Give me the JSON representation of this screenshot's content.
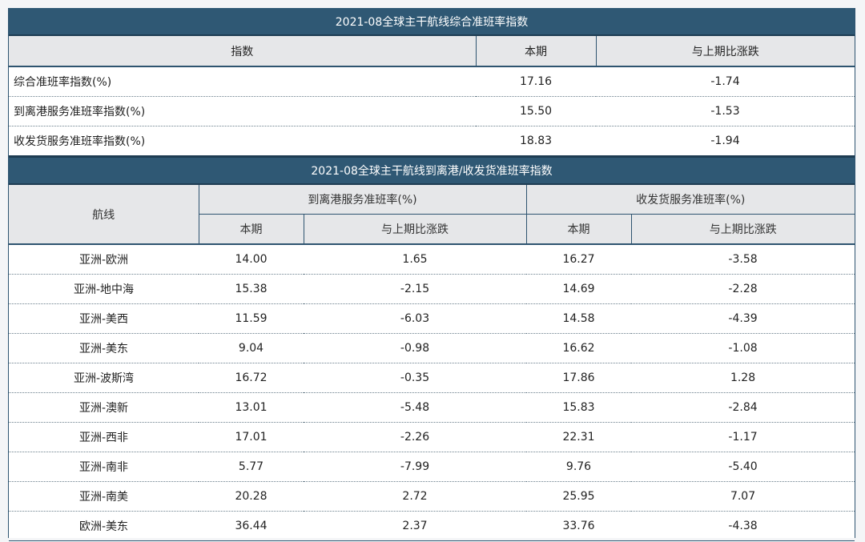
{
  "table1": {
    "title": "2021-08全球主干航线综合准班率指数",
    "headers": [
      "指数",
      "本期",
      "与上期比涨跌"
    ],
    "rows": [
      {
        "label": "综合准班率指数(%)",
        "current": "17.16",
        "change": "-1.74"
      },
      {
        "label": "到离港服务准班率指数(%)",
        "current": "15.50",
        "change": "-1.53"
      },
      {
        "label": "收发货服务准班率指数(%)",
        "current": "18.83",
        "change": "-1.94"
      }
    ]
  },
  "table2": {
    "title": "2021-08全球主干航线到离港/收发货准班率指数",
    "route_header": "航线",
    "group1_header": "到离港服务准班率(%)",
    "group2_header": "收发货服务准班率(%)",
    "sub_current": "本期",
    "sub_change": "与上期比涨跌",
    "rows": [
      {
        "route": "亚洲-欧洲",
        "arr_current": "14.00",
        "arr_change": "1.65",
        "ship_current": "16.27",
        "ship_change": "-3.58"
      },
      {
        "route": "亚洲-地中海",
        "arr_current": "15.38",
        "arr_change": "-2.15",
        "ship_current": "14.69",
        "ship_change": "-2.28"
      },
      {
        "route": "亚洲-美西",
        "arr_current": "11.59",
        "arr_change": "-6.03",
        "ship_current": "14.58",
        "ship_change": "-4.39"
      },
      {
        "route": "亚洲-美东",
        "arr_current": "9.04",
        "arr_change": "-0.98",
        "ship_current": "16.62",
        "ship_change": "-1.08"
      },
      {
        "route": "亚洲-波斯湾",
        "arr_current": "16.72",
        "arr_change": "-0.35",
        "ship_current": "17.86",
        "ship_change": "1.28"
      },
      {
        "route": "亚洲-澳新",
        "arr_current": "13.01",
        "arr_change": "-5.48",
        "ship_current": "15.83",
        "ship_change": "-2.84"
      },
      {
        "route": "亚洲-西非",
        "arr_current": "17.01",
        "arr_change": "-2.26",
        "ship_current": "22.31",
        "ship_change": "-1.17"
      },
      {
        "route": "亚洲-南非",
        "arr_current": "5.77",
        "arr_change": "-7.99",
        "ship_current": "9.76",
        "ship_change": "-5.40"
      },
      {
        "route": "亚洲-南美",
        "arr_current": "20.28",
        "arr_change": "2.72",
        "ship_current": "25.95",
        "ship_change": "7.07"
      },
      {
        "route": "欧洲-美东",
        "arr_current": "36.44",
        "arr_change": "2.37",
        "ship_current": "33.76",
        "ship_change": "-4.38"
      }
    ]
  },
  "colors": {
    "header_bg": "#2f5874",
    "subheader_bg": "#e6e7e9",
    "border": "#2e5470"
  }
}
